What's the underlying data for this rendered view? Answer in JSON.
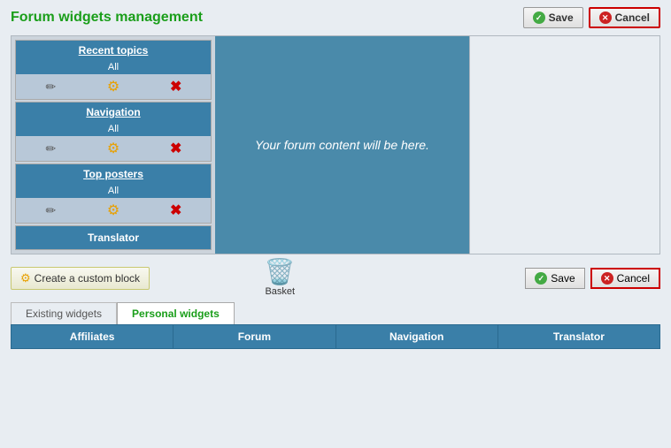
{
  "header": {
    "title": "Forum widgets management",
    "save_label": "Save",
    "cancel_label": "Cancel"
  },
  "widgets": [
    {
      "id": "recent-topics",
      "title": "Recent topics",
      "sub": "All",
      "has_controls": true
    },
    {
      "id": "navigation",
      "title": "Navigation",
      "sub": "All",
      "has_controls": true
    },
    {
      "id": "top-posters",
      "title": "Top posters",
      "sub": "All",
      "has_controls": true
    },
    {
      "id": "translator",
      "title": "Translator",
      "sub": null,
      "has_controls": false
    }
  ],
  "content_area": {
    "placeholder": "Your forum content will be here."
  },
  "bottom": {
    "create_custom_label": "Create a custom block",
    "basket_label": "Basket",
    "save_label": "Save",
    "cancel_label": "Cancel"
  },
  "tabs": [
    {
      "id": "existing",
      "label": "Existing widgets",
      "active": false
    },
    {
      "id": "personal",
      "label": "Personal widgets",
      "active": true
    }
  ],
  "categories": [
    {
      "id": "affiliates",
      "label": "Affiliates"
    },
    {
      "id": "forum",
      "label": "Forum"
    },
    {
      "id": "navigation",
      "label": "Navigation"
    },
    {
      "id": "translator",
      "label": "Translator"
    }
  ]
}
